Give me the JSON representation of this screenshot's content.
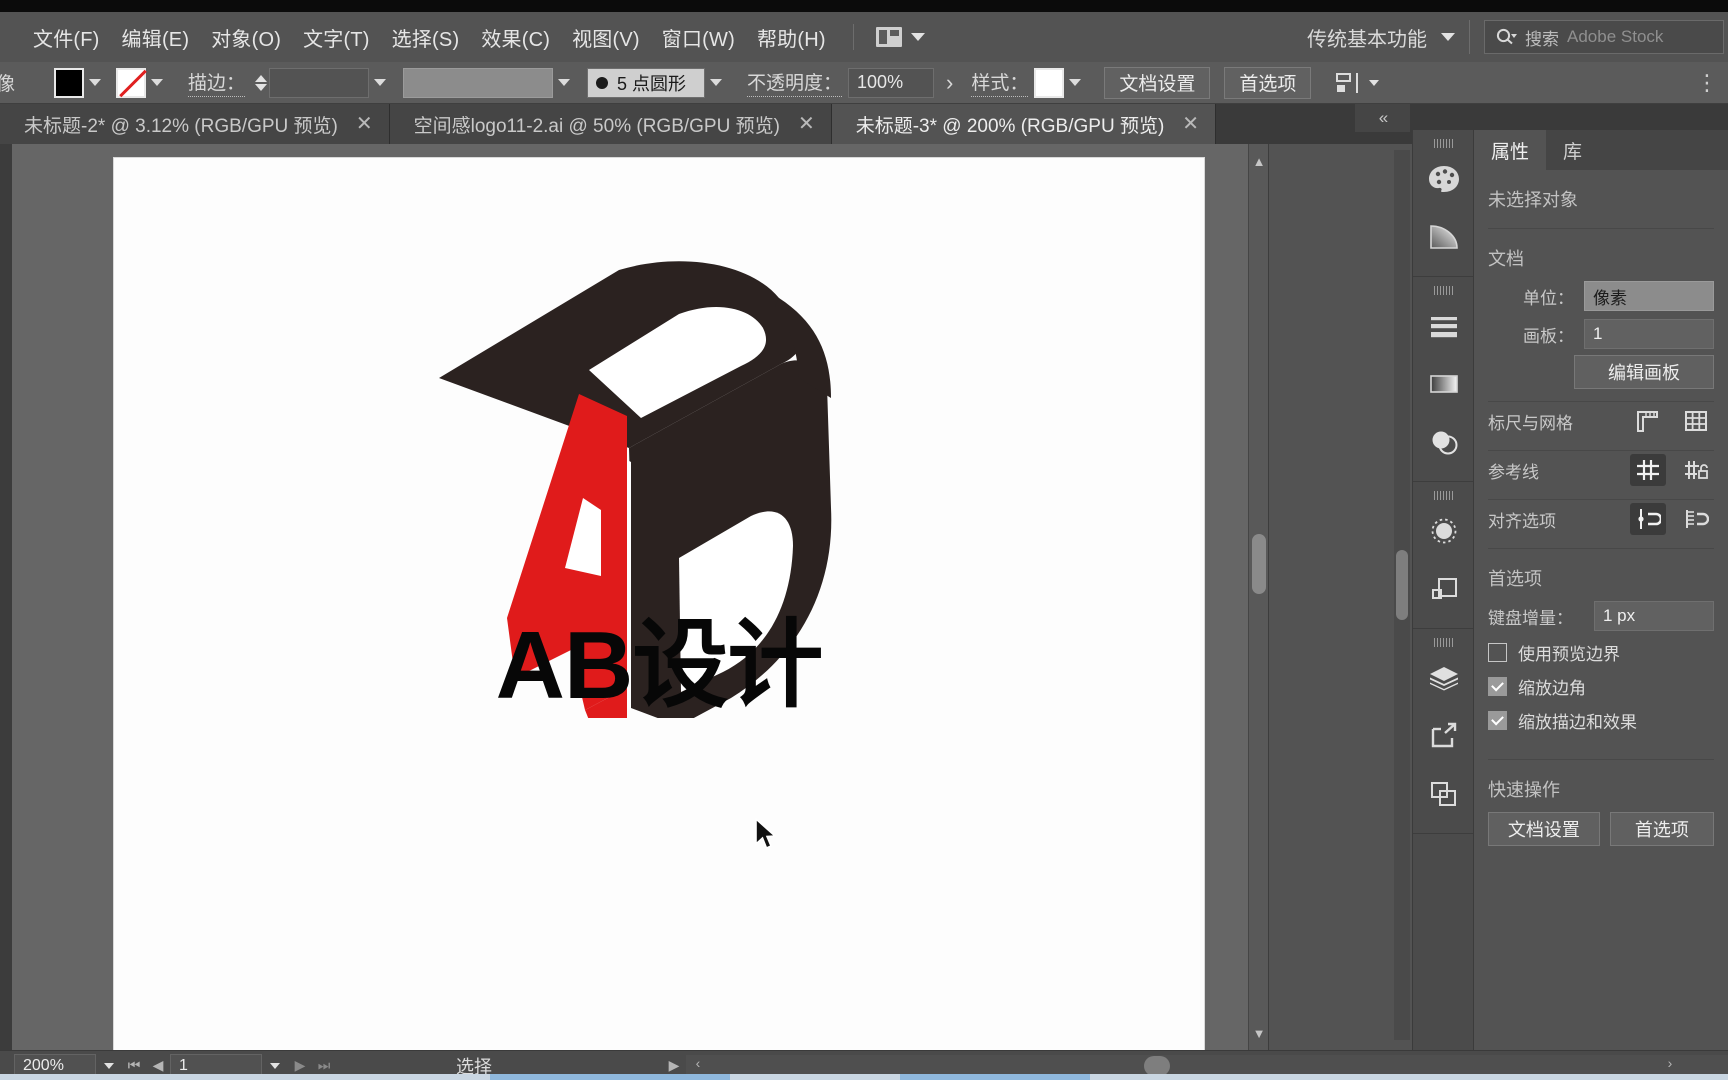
{
  "app": {
    "name": "Adobe Illustrator",
    "workspace": "传统基本功能"
  },
  "menubar": {
    "items": [
      {
        "label": "文件(F)",
        "name": "menu-file"
      },
      {
        "label": "编辑(E)",
        "name": "menu-edit"
      },
      {
        "label": "对象(O)",
        "name": "menu-object"
      },
      {
        "label": "文字(T)",
        "name": "menu-type"
      },
      {
        "label": "选择(S)",
        "name": "menu-select"
      },
      {
        "label": "效果(C)",
        "name": "menu-effect"
      },
      {
        "label": "视图(V)",
        "name": "menu-view"
      },
      {
        "label": "窗口(W)",
        "name": "menu-window"
      },
      {
        "label": "帮助(H)",
        "name": "menu-help"
      }
    ],
    "arrange_documents": "排列文档",
    "workspace_label": "传统基本功能",
    "search_label": "搜索",
    "search_placeholder": "Adobe Stock"
  },
  "controlbar": {
    "context_label": "像",
    "fill_swatch_color": "#000000",
    "stroke_swatch": "无",
    "stroke_label": "描边：",
    "stroke_weight_value": "",
    "stroke_profile_value": "",
    "brush_definition": "5 点圆形",
    "opacity_label": "不透明度：",
    "opacity_value": "100%",
    "style_label": "样式：",
    "doc_setup_button": "文档设置",
    "preferences_button": "首选项"
  },
  "tabs": [
    {
      "label": "未标题-2* @ 3.12% (RGB/GPU 预览)",
      "close": "✕",
      "active": false
    },
    {
      "label": "空间感logo11-2.ai @ 50% (RGB/GPU 预览)",
      "close": "✕",
      "active": false
    },
    {
      "label": "未标题-3* @ 200% (RGB/GPU 预览)",
      "close": "✕",
      "active": true
    }
  ],
  "artwork": {
    "brand_text": "AB设计",
    "logo_letter_a": "A",
    "logo_letter_b": "B",
    "color_red": "#E01B1B",
    "color_dark": "#2B2220"
  },
  "panel": {
    "collapse_glyph": "«",
    "tabs": [
      {
        "label": "属性",
        "active": true
      },
      {
        "label": "库",
        "active": false
      }
    ],
    "no_selection": "未选择对象",
    "document": {
      "heading": "文档",
      "units_label": "单位：",
      "units_value": "像素",
      "artboard_label": "画板：",
      "artboard_value": "1",
      "edit_artboards_button": "编辑画板"
    },
    "rulers_grid": {
      "label": "标尺与网格",
      "icons": [
        "ruler-icon",
        "grid-icon"
      ]
    },
    "guides": {
      "label": "参考线",
      "icons": [
        "show-guides-icon",
        "lock-guides-icon"
      ]
    },
    "snap_options": {
      "label": "对齐选项",
      "icons": [
        "snap-to-point-icon",
        "snap-to-grid-icon"
      ]
    },
    "preferences": {
      "heading": "首选项",
      "keyboard_increment_label": "键盘增量：",
      "keyboard_increment_value": "1 px",
      "checkboxes": [
        {
          "label": "使用预览边界",
          "checked": false
        },
        {
          "label": "缩放边角",
          "checked": true
        },
        {
          "label": "缩放描边和效果",
          "checked": true
        }
      ]
    },
    "quick_actions": {
      "heading": "快速操作",
      "buttons": [
        "文档设置",
        "首选项"
      ]
    }
  },
  "rail_icons": [
    "color-palette-icon",
    "gradient-icon",
    "stroke-icon",
    "gradient-panel-icon",
    "transparency-icon",
    "brushes-icon",
    "symbols-icon",
    "layers-icon",
    "asset-export-icon",
    "artboards-icon"
  ],
  "statusbar": {
    "zoom_value": "200%",
    "page_value": "1",
    "tool_status": "选择",
    "nav_first": "⏮",
    "nav_prev": "◀",
    "nav_next": "▶",
    "nav_last": "⏭"
  }
}
